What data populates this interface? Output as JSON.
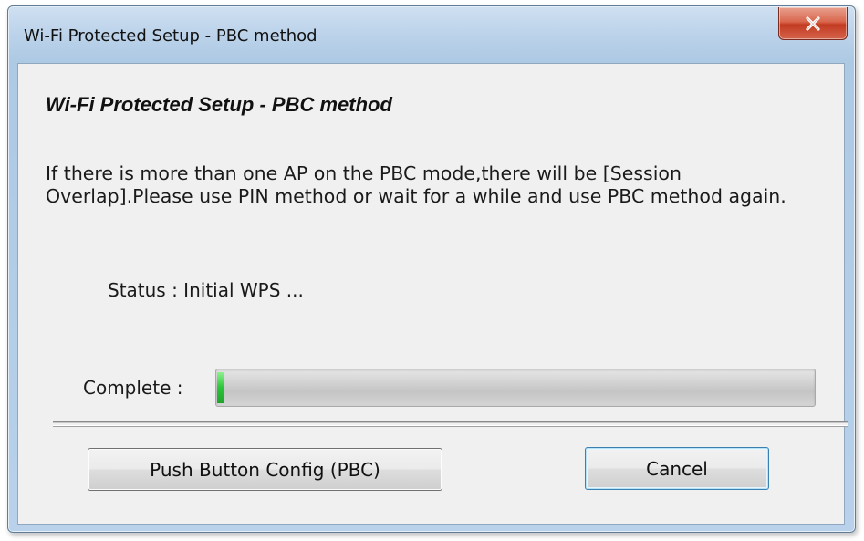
{
  "window": {
    "title": "Wi-Fi Protected Setup - PBC method"
  },
  "titlebar": {
    "close_icon": "close-x-icon"
  },
  "content": {
    "heading": "Wi-Fi Protected Setup - PBC method",
    "message_line1": "If there is more than one AP on the PBC mode,there will be [Session",
    "message_line2": "Overlap].Please use PIN method or wait for a while and use PBC method again.",
    "status": "Status : Initial WPS ...",
    "complete_label": "Complete :",
    "progress_percent": 1
  },
  "buttons": {
    "pbc_label": "Push Button Config (PBC)",
    "cancel_label": "Cancel"
  },
  "colors": {
    "close_button": "#c8422a",
    "progress_fill": "#2bc43a",
    "cancel_focus_border": "#3c7fb1"
  }
}
